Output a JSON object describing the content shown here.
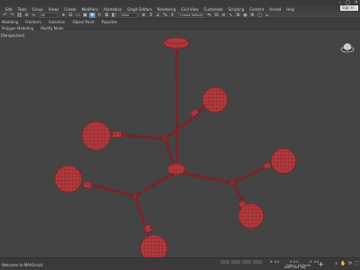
{
  "menu": {
    "items": [
      "Edit",
      "Tools",
      "Group",
      "Views",
      "Create",
      "Modifiers",
      "Animation",
      "Graph Editors",
      "Rendering",
      "Civil View",
      "Customize",
      "Scripting",
      "Content",
      "Arnold",
      "Help"
    ],
    "signin_label": "Sign In"
  },
  "toolbar": {
    "selection_filter": "All",
    "named_selection": "Create Selection Set"
  },
  "ribbon": {
    "tabs": [
      "Modeling",
      "Freeform",
      "Selection",
      "Object Paint",
      "Populate"
    ],
    "sub_tabs": [
      "Polygon Modeling",
      "Modify Mode"
    ]
  },
  "viewport": {
    "label": "[Perspective]"
  },
  "statusbar": {
    "message": "Welcome to MAXScript",
    "x": "X: 0.0",
    "y": "Y: 0.0",
    "z": "Z: 0.0",
    "grid": "Grid = 10.0mm",
    "add_time_tag": "Add Time Tag"
  },
  "colors": {
    "object": "#b13a3c",
    "wire": "#6e1e21",
    "viewport_bg": "#444444"
  }
}
